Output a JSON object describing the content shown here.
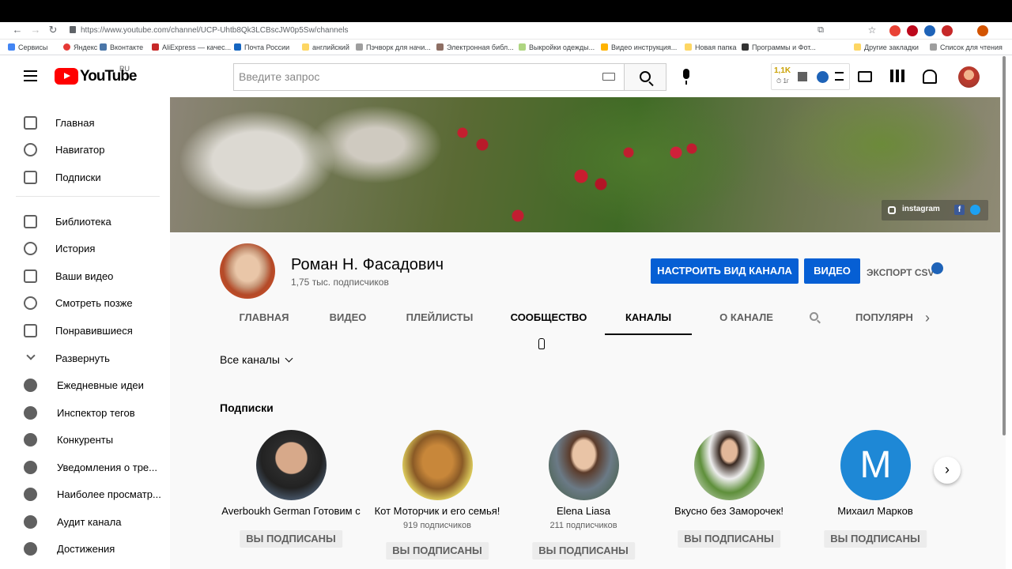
{
  "browser": {
    "url": "https://www.youtube.com/channel/UCP-Uhtb8Qk3LCBscJW0p5Sw/channels"
  },
  "bookmarks": [
    "Сервисы",
    "Яндекс",
    "Вконтакте",
    "AliExpress — качес...",
    "Почта России",
    "английский",
    "Пэчворк для начи...",
    "Электронная библ...",
    "Выкройки одежды...",
    "Видео инструкция...",
    "Новая папка",
    "Программы и Фот...",
    "Другие закладки",
    "Список для чтения"
  ],
  "masthead": {
    "logo": "YouTube",
    "region": "RU",
    "search_placeholder": "Введите запрос",
    "vidiq_count": "1,1K",
    "vidiq_sub": "⏱ 1г"
  },
  "sidebar": {
    "items": [
      "Главная",
      "Навигатор",
      "Подписки",
      "Библиотека",
      "История",
      "Ваши видео",
      "Смотреть позже",
      "Понравившиеся",
      "Развернуть",
      "Ежедневные идеи",
      "Инспектор тегов",
      "Конкуренты",
      "Уведомления о тре...",
      "Наиболее просматр...",
      "Аудит канала",
      "Достижения"
    ]
  },
  "banner": {
    "instagram": "instagram",
    "fb": "f"
  },
  "channel": {
    "name": "Роман Н. Фасадович",
    "subs": "1,75 тыс. подписчиков",
    "customize": "НАСТРОИТЬ ВИД КАНАЛА",
    "video": "ВИДЕО",
    "export": "ЭКСПОРТ CSV"
  },
  "tabs": [
    "ГЛАВНАЯ",
    "ВИДЕО",
    "ПЛЕЙЛИСТЫ",
    "СООБЩЕСТВО",
    "КАНАЛЫ",
    "О КАНАЛЕ",
    "ПОПУЛЯРНО"
  ],
  "filter": "Все каналы",
  "section": "Подписки",
  "cards": [
    {
      "name": "Averboukh German Готовим с",
      "subs": "",
      "btn": "ВЫ ПОДПИСАНЫ"
    },
    {
      "name": "Кот Моторчик и его семья!",
      "subs": "919 подписчиков",
      "btn": "ВЫ ПОДПИСАНЫ"
    },
    {
      "name": "Elena Liasa",
      "subs": "211 подписчиков",
      "btn": "ВЫ ПОДПИСАНЫ"
    },
    {
      "name": "Вкусно без Заморочек!",
      "subs": "",
      "btn": "ВЫ ПОДПИСАНЫ"
    },
    {
      "name": "Михаил Марков",
      "subs": "",
      "btn": "ВЫ ПОДПИСАНЫ",
      "letter": "M"
    }
  ]
}
